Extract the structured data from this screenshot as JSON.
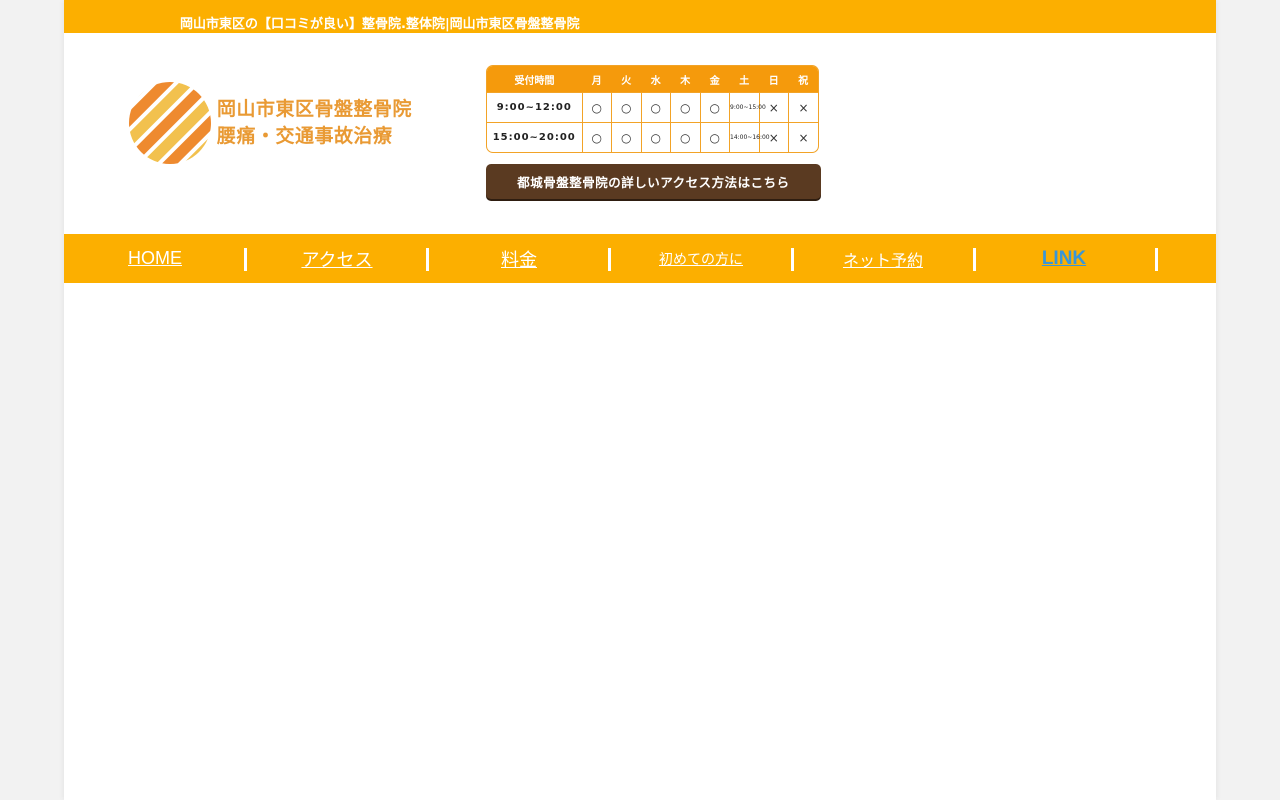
{
  "header": {
    "tagline": "岡山市東区の【口コミが良い】整骨院.整体院|岡山市東区骨盤整骨院"
  },
  "logo": {
    "line1": "岡山市東区骨盤整骨院",
    "line2": "腰痛・交通事故治療"
  },
  "hours": {
    "header": [
      "受付時間",
      "月",
      "火",
      "水",
      "木",
      "金",
      "土",
      "日",
      "祝"
    ],
    "rows": [
      {
        "time": "9:00~12:00",
        "cells": [
          "○",
          "○",
          "○",
          "○",
          "○",
          "9:00~15:00",
          "×",
          "×"
        ]
      },
      {
        "time": "15:00~20:00",
        "cells": [
          "○",
          "○",
          "○",
          "○",
          "○",
          "14:00~16:00",
          "×",
          "×"
        ]
      }
    ]
  },
  "access_button": "都城骨盤整骨院の詳しいアクセス方法はこちら",
  "nav": {
    "items": [
      "HOME",
      "アクセス",
      "料金",
      "初めての方に",
      "ネット予約",
      "LINK"
    ]
  },
  "colors": {
    "accent": "#fcaf00",
    "table_header": "#f59a0c",
    "button": "#5a3a21",
    "link": "#3a96d6"
  }
}
